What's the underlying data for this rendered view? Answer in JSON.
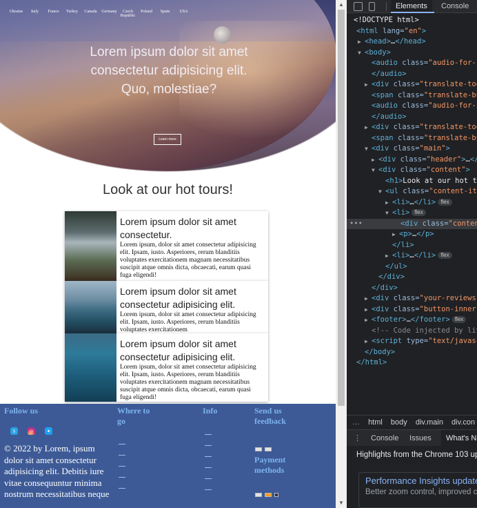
{
  "hero": {
    "nav": [
      "Ukraine",
      "Italy",
      "France",
      "Turkey",
      "Canada",
      "Germany",
      "Czech Republic",
      "Poland",
      "Spain",
      "USA"
    ],
    "title": "Lorem ipsum dolor sit amet consectetur adipisicing elit. Quo, molestiae?",
    "button": "Learn more"
  },
  "tours": {
    "heading": "Look at our hot tours!",
    "items": [
      {
        "title": "Lorem ipsum dolor sit amet consectetur.",
        "text": "Lorem ipsum, dolor sit amet consectetur adipisicing elit. Ipsam, iusto. Asperiores, rerum blanditiis voluptates exercitationem magnam necessitatibus suscipit atque omnis dicta, obcaecati, earum quasi fuga eligendi!"
      },
      {
        "title": "Lorem ipsum dolor sit amet consectetur adipisicing elit.",
        "text": "Lorem ipsum, dolor sit amet consectetur adipisicing elit. Ipsam, iusto. Asperiores, rerum blanditiis voluptates exercitationem"
      },
      {
        "title": "Lorem ipsum dolor sit amet consectetur adipisicing elit.",
        "text": "Lorem ipsum, dolor sit amet consectetur adipisicing elit. Ipsam, iusto. Asperiores, rerum blanditiis voluptates exercitationem magnam necessitatibus suscipit atque omnis dicta, obcaecati, earum quasi fuga eligendi!"
      }
    ]
  },
  "footer": {
    "follow_us": "Follow us",
    "where_to_go": "Where to go",
    "info": "Info",
    "send_feedback": "Send us feedback",
    "payment_methods": "Payment methods",
    "copyright": "© 2022 by Lorem, ipsum dolor sit amet consectetur adipisicing elit. Debitis iure vitae consequuntur minima nostrum necessitatibus neque",
    "social_icons": [
      "skype-icon",
      "instagram-icon",
      "twitter-icon"
    ]
  },
  "devtools": {
    "tabs": {
      "elements": "Elements",
      "console": "Console"
    },
    "breadcrumbs": [
      "html",
      "body",
      "div.main",
      "div.con"
    ],
    "drawer_tabs": {
      "menu": "⋮",
      "console": "Console",
      "issues": "Issues",
      "whats_new": "What's N"
    },
    "whats_new": {
      "highlights": "Highlights from the Chrome 103 upd",
      "card_title": "Performance Insights updates",
      "card_sub": "Better zoom control, improved c"
    },
    "badges": {
      "flex": "flex"
    }
  },
  "colors": {
    "footer_bg": "#3d5a96",
    "footer_heading": "#7db4ee",
    "devtools_bg": "#202124",
    "tag": "#5db0d7",
    "attr_value": "#f29766"
  }
}
